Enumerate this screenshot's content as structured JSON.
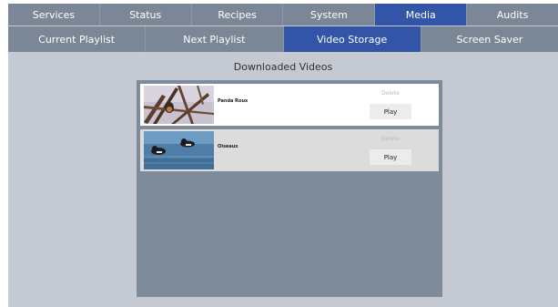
{
  "top_nav": {
    "items": [
      {
        "label": "Services",
        "active": false
      },
      {
        "label": "Status",
        "active": false
      },
      {
        "label": "Recipes",
        "active": false
      },
      {
        "label": "System",
        "active": false
      },
      {
        "label": "Media",
        "active": true
      },
      {
        "label": "Audits",
        "active": false
      }
    ]
  },
  "sub_nav": {
    "items": [
      {
        "label": "Current Playlist",
        "active": false
      },
      {
        "label": "Next Playlist",
        "active": false
      },
      {
        "label": "Video Storage",
        "active": true
      },
      {
        "label": "Screen Saver",
        "active": false
      }
    ]
  },
  "main": {
    "title": "Downloaded Videos",
    "videos": [
      {
        "title": "Panda Roux",
        "delete_label": "Delete",
        "play_label": "Play",
        "thumbnail": "bird-in-branches-thumbnail"
      },
      {
        "title": "Oiseaux",
        "delete_label": "Delete",
        "play_label": "Play",
        "thumbnail": "ducks-on-water-thumbnail"
      }
    ]
  },
  "colors": {
    "nav_background": "#7b8796",
    "nav_active": "#3355a8",
    "page_background": "#c4c9d2",
    "list_panel": "#7d8b9a"
  }
}
